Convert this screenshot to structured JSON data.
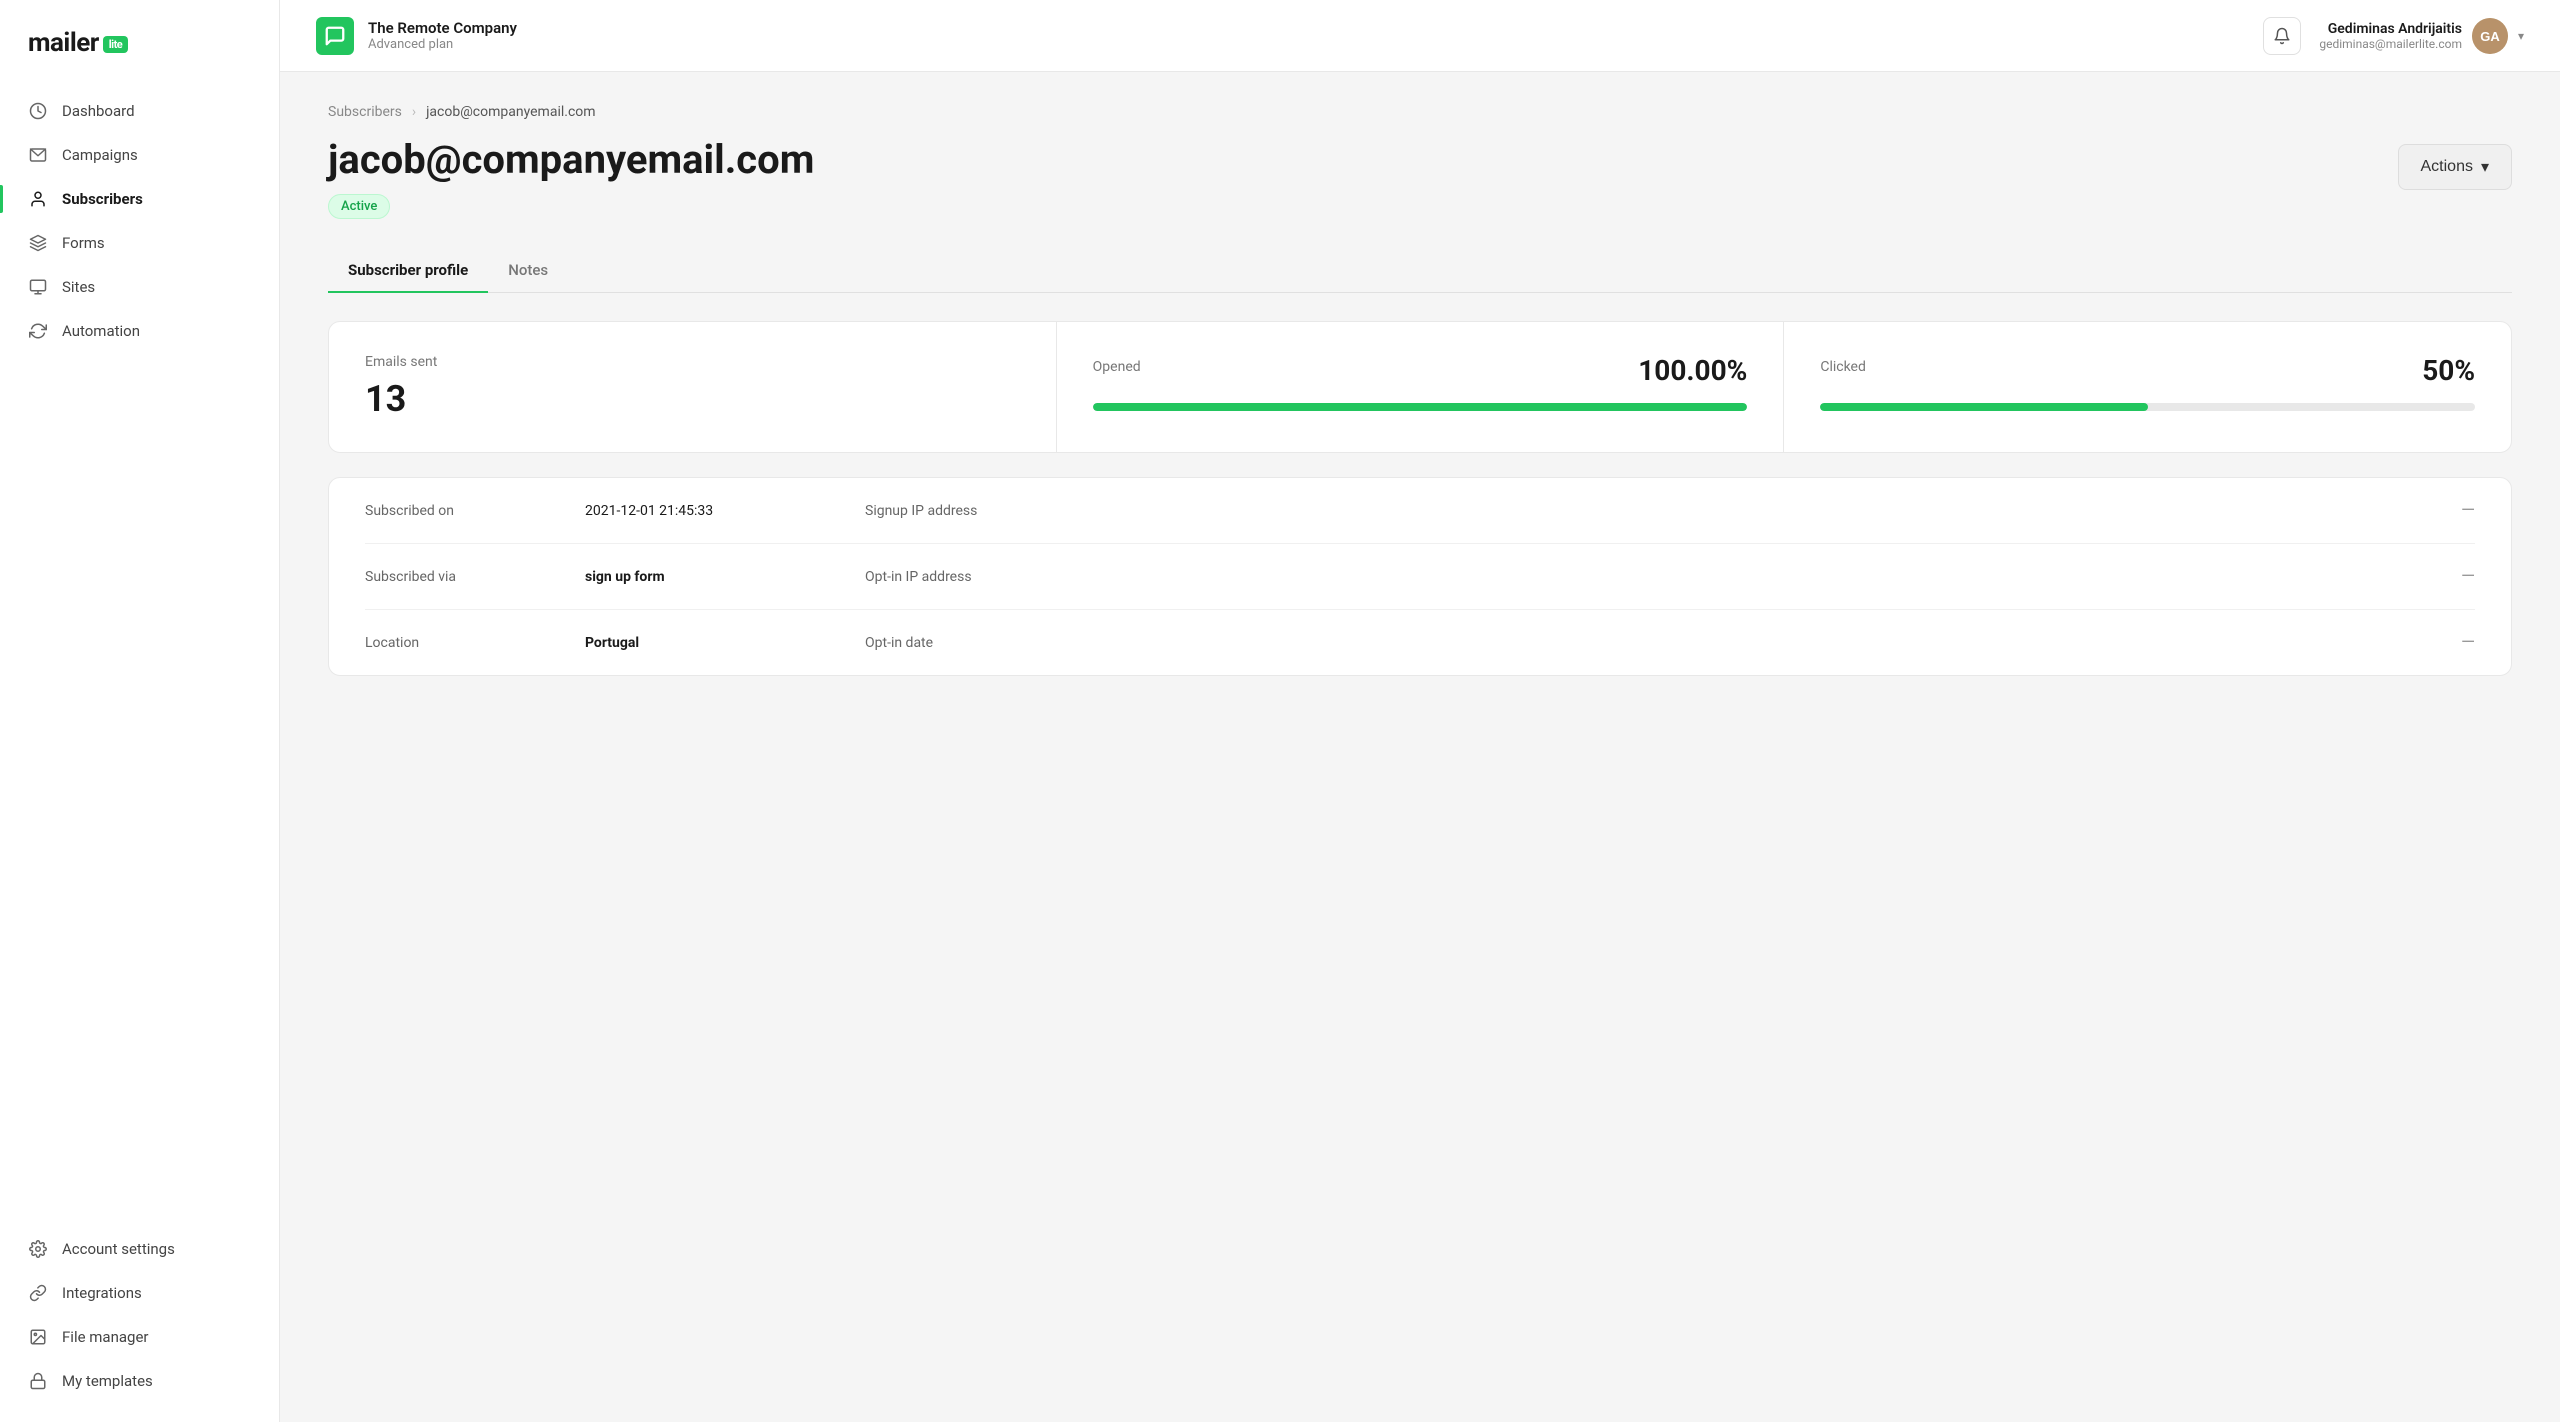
{
  "logo": {
    "text": "mailer",
    "badge": "lite"
  },
  "sidebar": {
    "items": [
      {
        "id": "dashboard",
        "label": "Dashboard",
        "icon": "clock"
      },
      {
        "id": "campaigns",
        "label": "Campaigns",
        "icon": "mail"
      },
      {
        "id": "subscribers",
        "label": "Subscribers",
        "icon": "person",
        "active": true
      },
      {
        "id": "forms",
        "label": "Forms",
        "icon": "layers"
      },
      {
        "id": "sites",
        "label": "Sites",
        "icon": "browser"
      },
      {
        "id": "automation",
        "label": "Automation",
        "icon": "refresh"
      }
    ],
    "bottom_items": [
      {
        "id": "account-settings",
        "label": "Account settings",
        "icon": "gear"
      },
      {
        "id": "integrations",
        "label": "Integrations",
        "icon": "link"
      },
      {
        "id": "file-manager",
        "label": "File manager",
        "icon": "image"
      },
      {
        "id": "my-templates",
        "label": "My templates",
        "icon": "lock"
      }
    ]
  },
  "topbar": {
    "company_name": "The Remote Company",
    "company_plan": "Advanced plan",
    "bell_label": "Notifications",
    "user_name": "Gediminas Andrijaitis",
    "user_email": "gediminas@mailerlite.com",
    "user_initials": "GA"
  },
  "breadcrumb": {
    "parent": "Subscribers",
    "current": "jacob@companyemail.com"
  },
  "page": {
    "title": "jacob@companyemail.com",
    "status": "Active",
    "actions_label": "Actions"
  },
  "tabs": [
    {
      "id": "profile",
      "label": "Subscriber profile",
      "active": true
    },
    {
      "id": "notes",
      "label": "Notes",
      "active": false
    }
  ],
  "stats": {
    "emails_sent_label": "Emails sent",
    "emails_sent_value": "13",
    "opened_label": "Opened",
    "opened_percent": "100.00%",
    "opened_fill": 100,
    "clicked_label": "Clicked",
    "clicked_percent": "50%",
    "clicked_fill": 50
  },
  "info": {
    "subscribed_on_label": "Subscribed on",
    "subscribed_on_value": "2021-12-01 21:45:33",
    "signup_ip_label": "Signup IP address",
    "signup_ip_value": "—",
    "subscribed_via_label": "Subscribed via",
    "subscribed_via_value": "sign up form",
    "optin_ip_label": "Opt-in IP address",
    "optin_ip_value": "—",
    "location_label": "Location",
    "location_value": "Portugal",
    "optin_date_label": "Opt-in date",
    "optin_date_value": "—"
  }
}
